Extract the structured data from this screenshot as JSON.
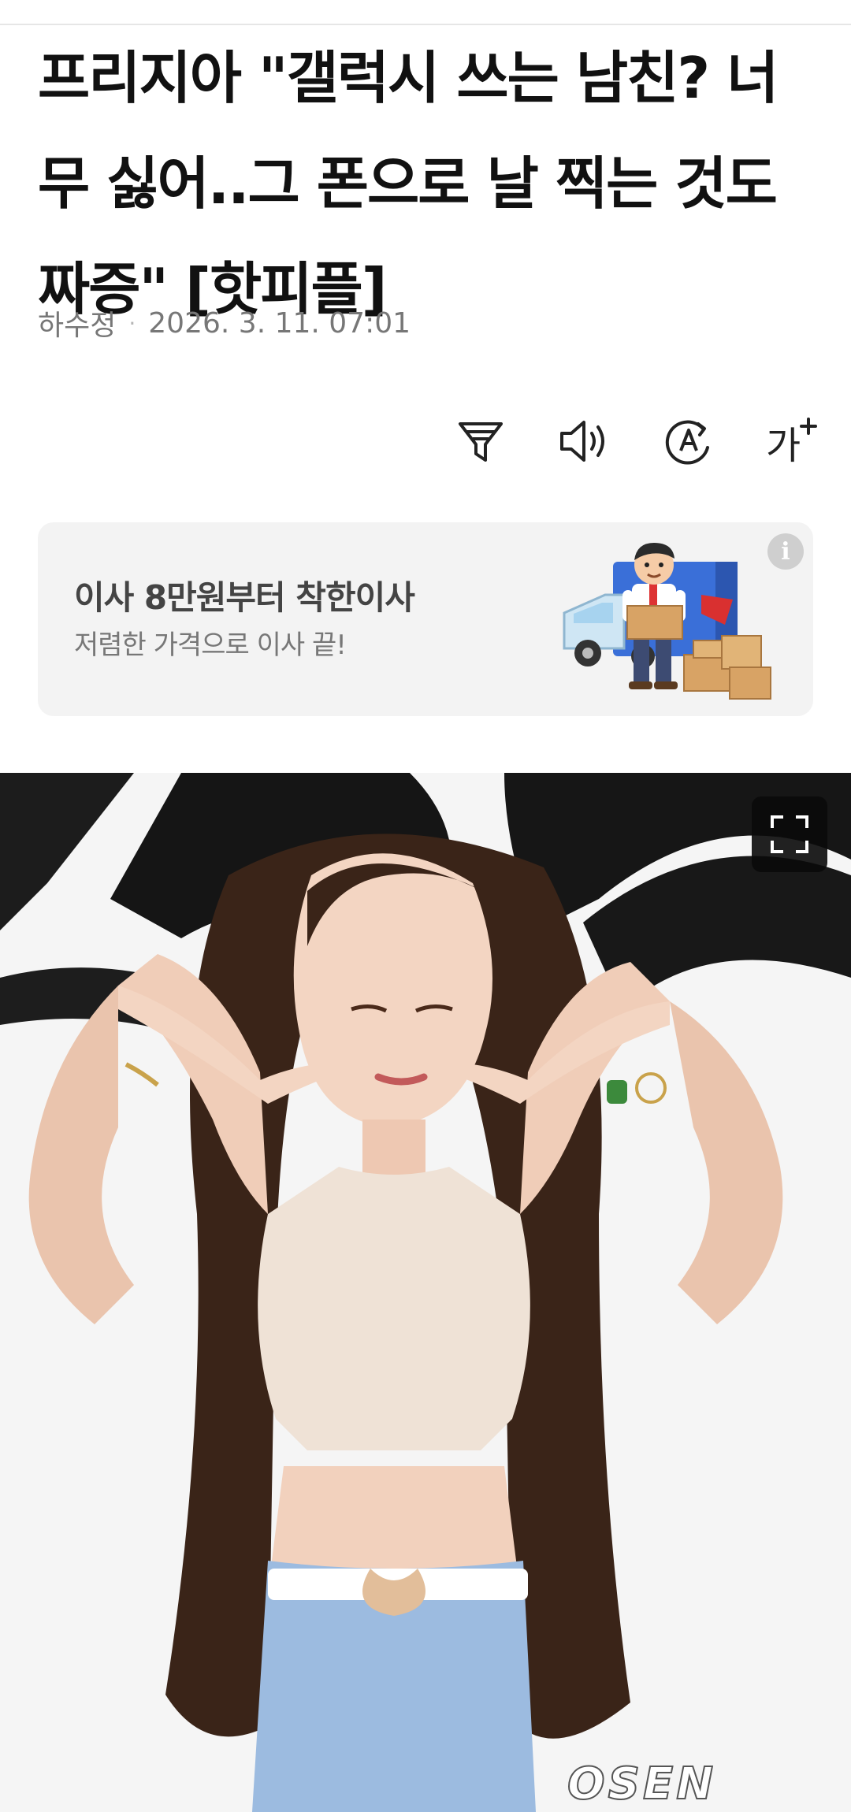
{
  "article": {
    "headline": "프리지아 \"갤럭시 쓰는 남친? 너무 싫어..그 폰으로 날 찍는 것도 짜증\" [핫피플]",
    "author": "하수정",
    "separator": "·",
    "datetime": "2026. 3. 11. 07:01"
  },
  "toolbar": {
    "items": [
      {
        "icon": "filter-funnel-icon",
        "action": "summary"
      },
      {
        "icon": "speaker-icon",
        "action": "listen"
      },
      {
        "icon": "translate-icon",
        "action": "translate"
      },
      {
        "icon": "font-size-icon",
        "action": "text-size",
        "label": "가"
      }
    ]
  },
  "ad": {
    "title": "이사 8만원부터 착한이사",
    "subtitle": "저렴한 가격으로 이사 끝!",
    "info_icon": "info-icon",
    "info_label": "i"
  },
  "photo": {
    "watermark": "OSEN",
    "fullscreen_icon": "fullscreen-icon"
  },
  "colors": {
    "text": "#111111",
    "meta": "#777777",
    "ad_bg": "#f3f3f3",
    "ad_title": "#444444",
    "photo_dark": "#111111"
  }
}
